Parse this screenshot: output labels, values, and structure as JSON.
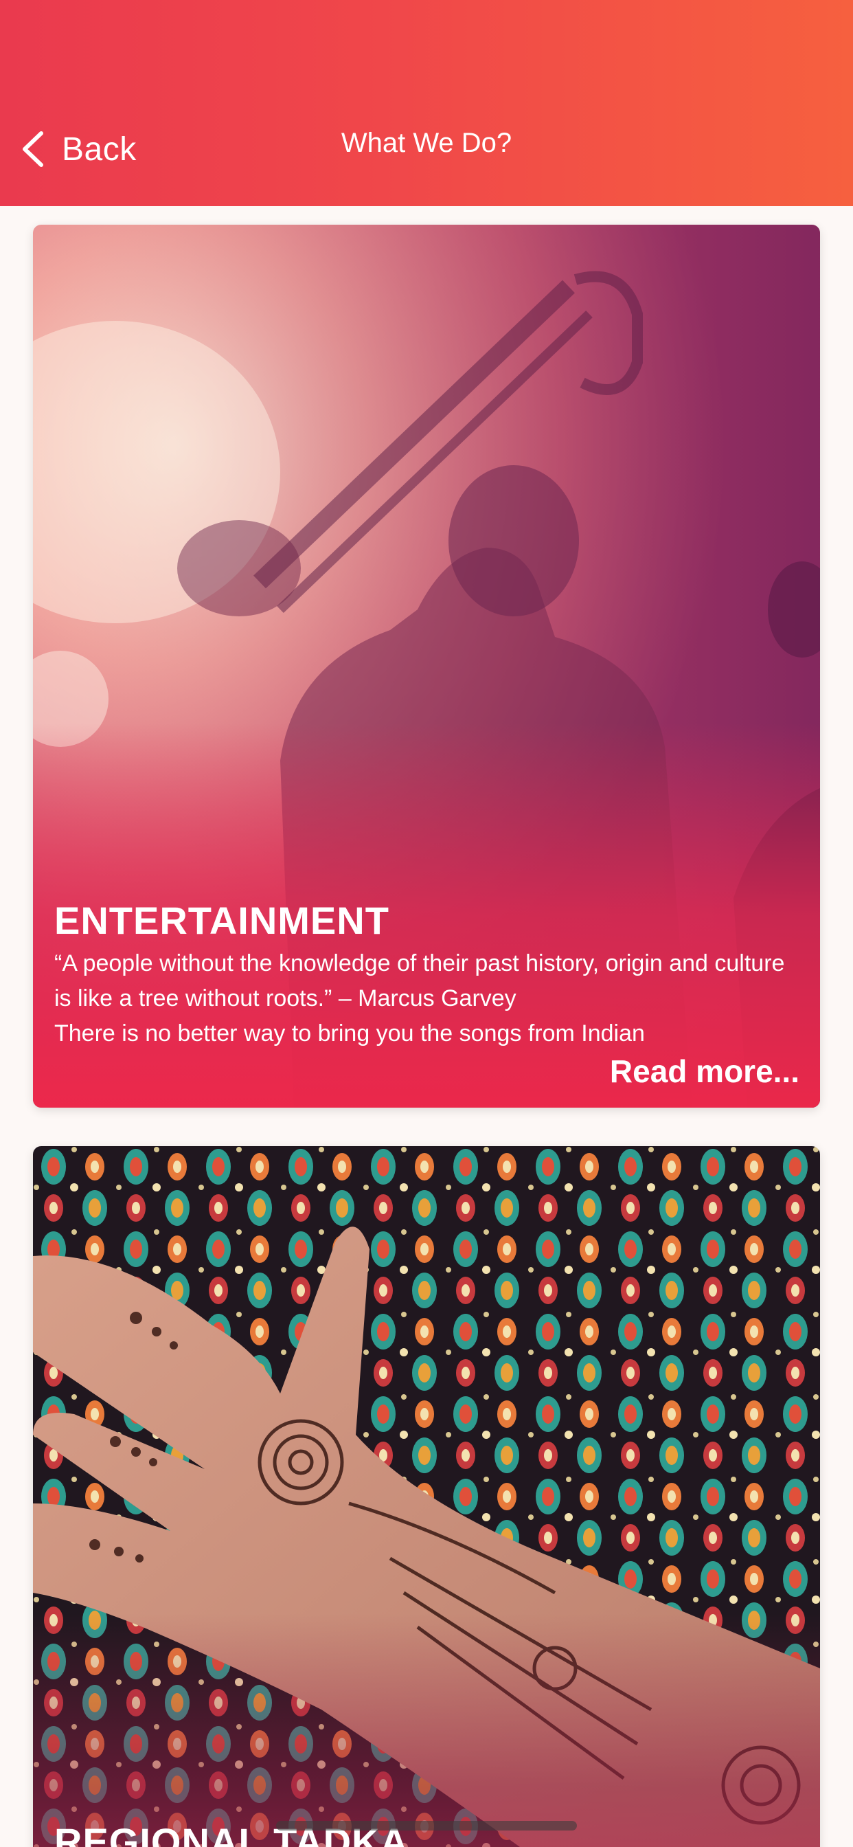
{
  "header": {
    "back_label": "Back",
    "title": "What We Do?",
    "gradient_start": "#ea3a4e",
    "gradient_end": "#f6603f"
  },
  "cards": [
    {
      "title": "ENTERTAINMENT",
      "excerpt": "“A people without the knowledge of their past history, origin and culture is like a tree without roots.” – Marcus Garvey\n There is no better way to bring you the songs from Indian",
      "read_more": "Read more...",
      "image": "musician-performing-photo"
    },
    {
      "title": "REGIONAL TADKA",
      "image": "henna-hand-on-mandala-fabric-photo"
    }
  ],
  "colors": {
    "background": "#fdf8f6",
    "card_overlay": "#ee284a"
  }
}
